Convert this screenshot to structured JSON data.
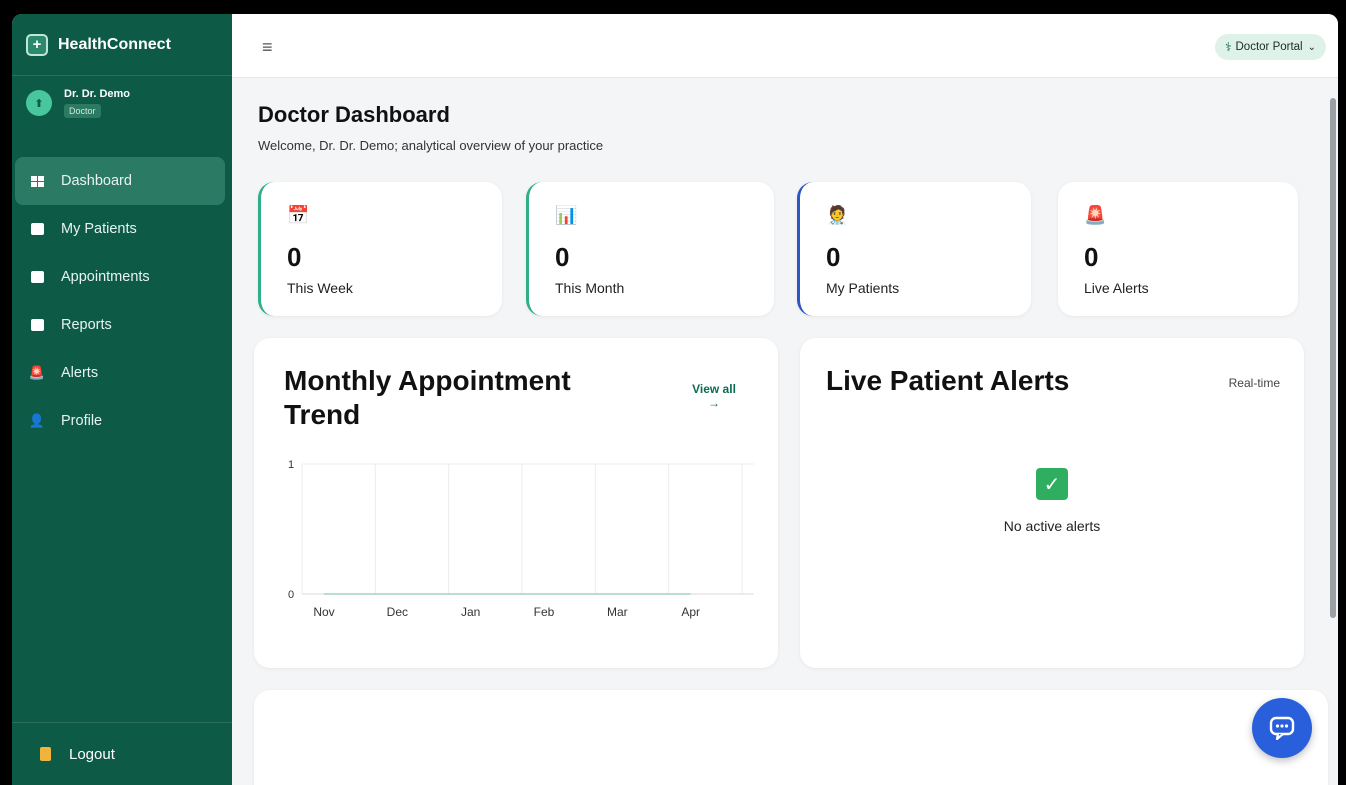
{
  "brand": {
    "name": "HealthConnect",
    "icon": "plus-icon"
  },
  "user": {
    "name": "Dr. Dr. Demo",
    "role": "Doctor"
  },
  "nav": {
    "items": [
      {
        "label": "Dashboard",
        "icon": "dashboard-grid-icon",
        "active": true
      },
      {
        "label": "My Patients",
        "icon": "patients-icon"
      },
      {
        "label": "Appointments",
        "icon": "appointments-icon"
      },
      {
        "label": "Reports",
        "icon": "reports-icon"
      },
      {
        "label": "Alerts",
        "icon": "alerts-icon"
      },
      {
        "label": "Profile",
        "icon": "profile-icon"
      }
    ],
    "logout": "Logout"
  },
  "topbar": {
    "menu_icon": "≡",
    "portal_label": "Doctor Portal"
  },
  "page": {
    "title": "Doctor Dashboard",
    "subtitle": "Welcome, Dr. Dr. Demo; analytical overview of your practice"
  },
  "stats": [
    {
      "value": "0",
      "label": "This Week",
      "icon": "calendar-icon",
      "glyph": "📅",
      "accent": "#2fae87"
    },
    {
      "value": "0",
      "label": "This Month",
      "icon": "bar-chart-icon",
      "glyph": "📊",
      "accent": "#2fae87"
    },
    {
      "value": "0",
      "label": "My Patients",
      "icon": "doctor-icon",
      "glyph": "🧑‍⚕️",
      "accent": "#2f55c4"
    },
    {
      "value": "0",
      "label": "Live Alerts",
      "icon": "siren-icon",
      "glyph": "🚨",
      "accent": ""
    }
  ],
  "trend": {
    "title": "Monthly Appointment Trend",
    "view_all": "View all →"
  },
  "alerts_card": {
    "title": "Live Patient Alerts",
    "tag": "Real-time",
    "empty_text": "No active alerts"
  },
  "chart_data": {
    "type": "line",
    "categories": [
      "Nov",
      "Dec",
      "Jan",
      "Feb",
      "Mar",
      "Apr"
    ],
    "series": [
      {
        "values": [
          0,
          0,
          0,
          0,
          0,
          0
        ]
      }
    ],
    "yticks": [
      "0",
      "1"
    ],
    "ylim": [
      0,
      1
    ],
    "title": "Monthly Appointment Trend",
    "grid": true
  },
  "colors": {
    "sidebar": "#0d5a47",
    "accent": "#2fae87",
    "fab": "#2a5fdb"
  }
}
